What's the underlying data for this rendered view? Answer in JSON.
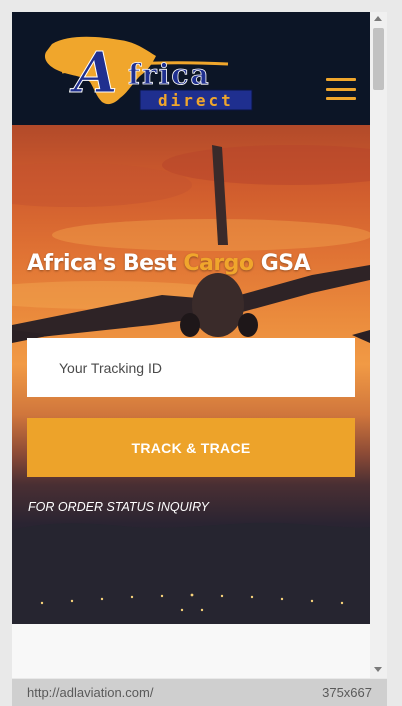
{
  "header": {
    "logo_text_main": "frica",
    "logo_text_sub": "direct",
    "logo_letter": "A",
    "menu_icon": "hamburger-menu-icon"
  },
  "hero": {
    "title_prefix": "Africa's Best ",
    "title_accent": "Cargo",
    "title_suffix": " GSA",
    "tracking_placeholder": "Your Tracking ID",
    "track_button_label": "TRACK & TRACE",
    "inquiry_text": "FOR ORDER STATUS INQUIRY"
  },
  "status_bar": {
    "url": "http://adlaviation.com/",
    "viewport_size": "375x667"
  },
  "colors": {
    "header_bg": "#0c1526",
    "accent": "#f0a62c",
    "button_bg": "#eda32a",
    "logo_blue": "#1f2f8f"
  }
}
